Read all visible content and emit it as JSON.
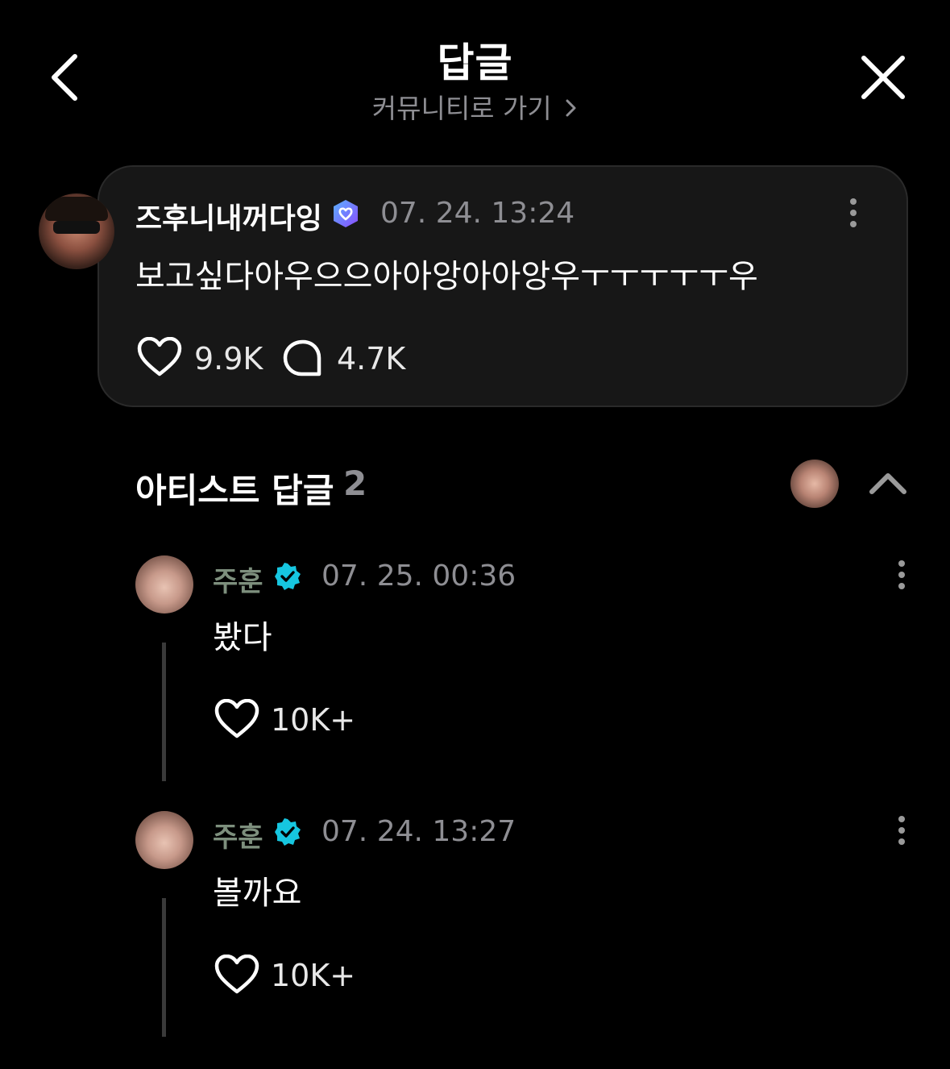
{
  "header": {
    "title": "답글",
    "subtitle": "커뮤니티로 가기",
    "back_icon": "chevron-left-icon",
    "close_icon": "close-icon"
  },
  "post": {
    "author": "즈후니내꺼다잉",
    "timestamp": "07. 24. 13:24",
    "text": "보고싶다아우으으아아앙아아앙우ㅜㅜㅜㅜㅜ우",
    "likes": "9.9K",
    "comments": "4.7K",
    "badge_color": "#7b5cff"
  },
  "artist_replies": {
    "title": "아티스트 답글",
    "count": "2",
    "items": [
      {
        "author": "주훈",
        "timestamp": "07. 25. 00:36",
        "text": "봤다",
        "likes": "10K+"
      },
      {
        "author": "주훈",
        "timestamp": "07. 24. 13:27",
        "text": "볼까요",
        "likes": "10K+"
      }
    ],
    "badge_color": "#16c6e0"
  }
}
